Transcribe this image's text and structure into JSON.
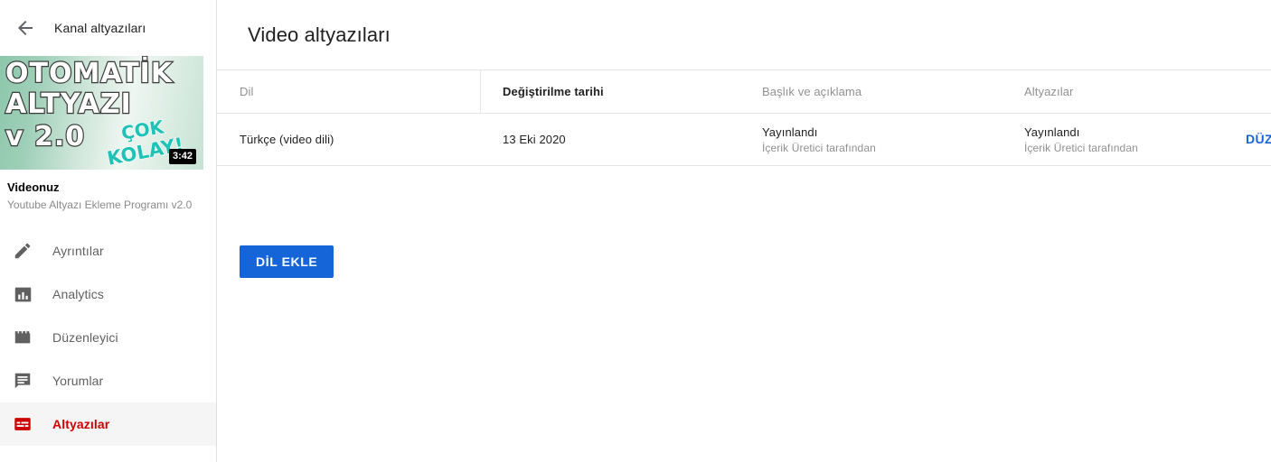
{
  "sidebar": {
    "back_icon": "arrow-left-icon",
    "header_title": "Kanal altyazıları",
    "thumbnail": {
      "line1": "OTOMATİK",
      "line2": "ALTYAZI",
      "line3": "v 2.0",
      "teal1": "ÇOK",
      "teal2": "KOLAY!",
      "duration": "3:42"
    },
    "video_title": "Videonuz",
    "video_subtitle": "Youtube Altyazı Ekleme Programı v2.0",
    "items": [
      {
        "label": "Ayrıntılar",
        "icon": "pencil-icon",
        "active": false
      },
      {
        "label": "Analytics",
        "icon": "bar-chart-icon",
        "active": false
      },
      {
        "label": "Düzenleyici",
        "icon": "clapperboard-icon",
        "active": false
      },
      {
        "label": "Yorumlar",
        "icon": "comment-icon",
        "active": false
      },
      {
        "label": "Altyazılar",
        "icon": "subtitles-icon",
        "active": true
      }
    ]
  },
  "main": {
    "title": "Video altyazıları",
    "table": {
      "columns": [
        "Dil",
        "Değiştirilme tarihi",
        "Başlık ve açıklama",
        "Altyazılar",
        ""
      ],
      "rows": [
        {
          "language": "Türkçe (video dili)",
          "modified": "13 Eki 2020",
          "title_status": "Yayınlandı",
          "title_by": "İçerik Üretici tarafından",
          "subtitle_status": "Yayınlandı",
          "subtitle_by": "İçerik Üretici tarafından",
          "action": "DÜZENLE"
        }
      ]
    },
    "add_language_button": "DİL EKLE"
  },
  "colors": {
    "accent_blue": "#1565d8",
    "active_red": "#cc0000",
    "thumb_teal": "#1fc2b5",
    "border": "#e5e5e5"
  }
}
